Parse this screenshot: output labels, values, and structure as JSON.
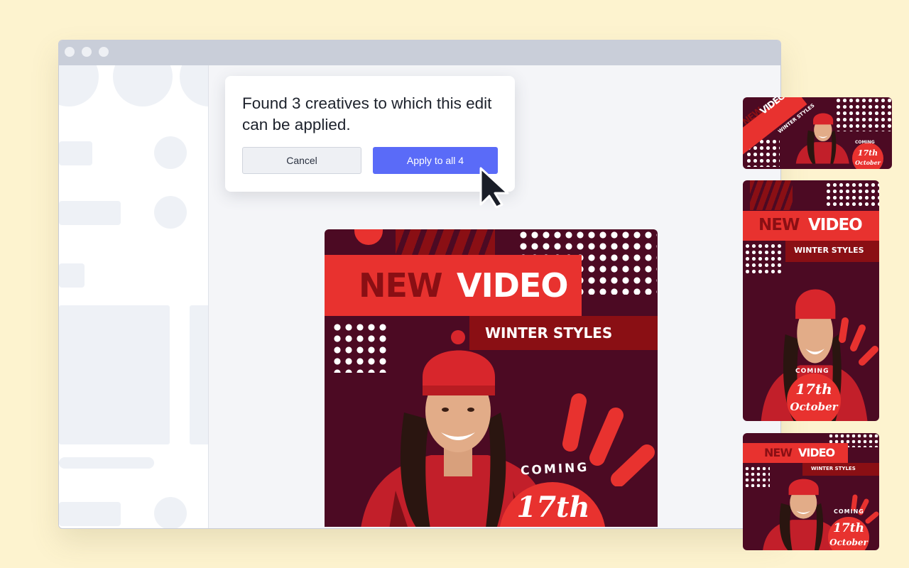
{
  "dialog": {
    "message": "Found 3 creatives to which this edit can be applied.",
    "cancel_label": "Cancel",
    "apply_label": "Apply to all 4"
  },
  "creative": {
    "headline_word1": "NEW",
    "headline_word2": "VIDEO",
    "subheadline": "WINTER STYLES",
    "coming": "COMING",
    "date_day": "17th",
    "date_month": "October"
  },
  "colors": {
    "background": "#fdf3cf",
    "primary_button": "#5a6bf8",
    "creative_background": "#4c0a23",
    "creative_red": "#e8322f",
    "creative_dark_red": "#8a0f14"
  },
  "icons": [
    "mouse-pointer-icon",
    "curved-arrow-icon"
  ]
}
